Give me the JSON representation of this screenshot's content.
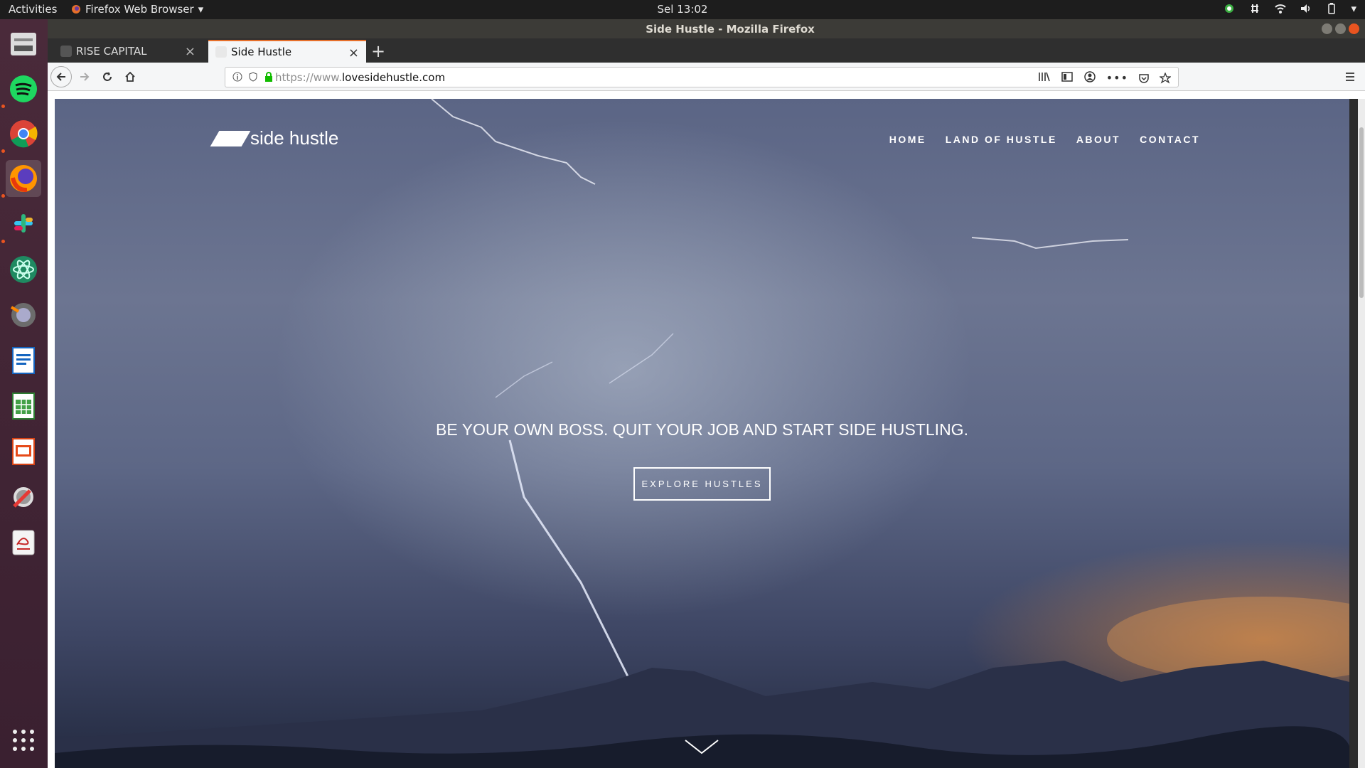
{
  "topbar": {
    "activities": "Activities",
    "app_menu": "Firefox Web Browser",
    "clock": "Sel 13:02"
  },
  "window": {
    "title": "Side Hustle - Mozilla Firefox"
  },
  "dock": {
    "items": [
      "files",
      "spotify",
      "chrome",
      "firefox",
      "slack",
      "atom",
      "gimp",
      "writer",
      "calc",
      "impress",
      "settings",
      "evince",
      "show-apps"
    ]
  },
  "tabs": [
    {
      "label": "RISE CAPITAL",
      "selected": false
    },
    {
      "label": "Side Hustle",
      "selected": true
    }
  ],
  "navbar": {
    "url_prefix": "https://www.",
    "url_domain": "lovesidehustle.com"
  },
  "page": {
    "logo": "side hustle",
    "nav": [
      "HOME",
      "LAND OF HUSTLE",
      "ABOUT",
      "CONTACT"
    ],
    "headline": "BE YOUR OWN BOSS. QUIT YOUR JOB AND START SIDE HUSTLING.",
    "cta": "EXPLORE HUSTLES"
  },
  "colors": {
    "accent": "#e66f2a",
    "dock": "#3a2030",
    "hero": "#5d6786"
  }
}
